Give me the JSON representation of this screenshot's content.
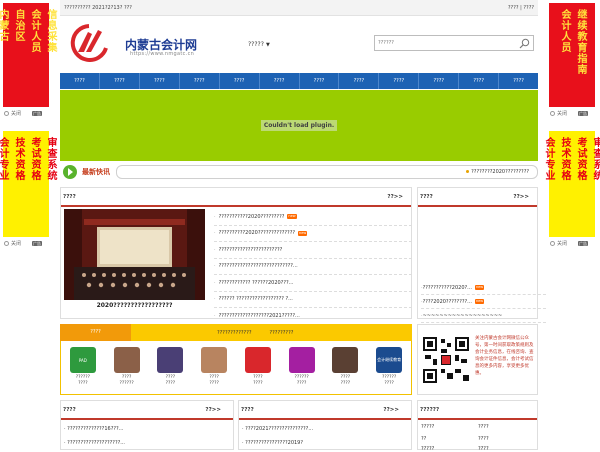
{
  "left_ads": [
    {
      "cols": [
        "内蒙古",
        "自治区"
      ],
      "cols2": [
        "会计人员",
        "信息采集"
      ],
      "theme": "red",
      "close": "关闭",
      "badge": "广告"
    },
    {
      "cols": [
        "会计专业",
        "技术资格"
      ],
      "cols2": [
        "考试资格",
        "审查系统"
      ],
      "theme": "yellow",
      "close": "关闭",
      "badge": "广告"
    }
  ],
  "right_ads": [
    {
      "cols": [
        "会计人员"
      ],
      "cols2": [
        "继续教育指南"
      ],
      "theme": "red",
      "close": "关闭",
      "badge": "广告"
    },
    {
      "cols": [
        "会计专业",
        "技术资格"
      ],
      "cols2": [
        "考试资格",
        "审查系统"
      ],
      "theme": "yellow",
      "close": "关闭",
      "badge": "广告"
    }
  ],
  "topbar": {
    "left": "?????????? 2021?2?13? ???",
    "right": "???? | ????"
  },
  "header": {
    "site_name": "内蒙古会计网",
    "site_url": "https://www.nmgatc.cn",
    "menu_label": "?????",
    "search_placeholder": "??????"
  },
  "nav": [
    "????",
    "????",
    "????",
    "????",
    "????",
    "????",
    "????",
    "????",
    "????",
    "????",
    "????",
    "????"
  ],
  "plugin_message": "Couldn't load plugin.",
  "ticker": {
    "title": "最新快讯",
    "text": "????????2020?????????"
  },
  "news_panel": {
    "title": "????",
    "more": "??>>",
    "photo_caption": "2020?????????????????",
    "photo_banner": "",
    "items": [
      {
        "text": "???????????2020?????????",
        "new": true
      },
      {
        "text": "??????????2020??????????????",
        "new": true
      },
      {
        "text": "????????????????????????",
        "new": false
      },
      {
        "text": "????????????????????????????...",
        "new": false
      },
      {
        "text": "???????????? ??????2020???...",
        "new": false
      },
      {
        "text": "?????? ?????????????????? ?...",
        "new": false
      },
      {
        "text": "???????????????????2021?????...",
        "new": false
      }
    ]
  },
  "notice_panel": {
    "title": "????",
    "more": "??>>",
    "items": [
      {
        "text": "???????????2020?...",
        "new": true
      },
      {
        "text": "????2020????????...",
        "new": true
      },
      {
        "text": "~~~~~~~~~~~~~~~~~~~",
        "new": false
      }
    ]
  },
  "service": {
    "tab_active": "????",
    "tab_others": [
      "?????????????",
      "?????????"
    ],
    "items": [
      {
        "label": "??????\n????",
        "color": "#2e9a3e",
        "badge_text": "PAD"
      },
      {
        "label": "????\n??????",
        "color": "#8b6048",
        "badge_text": ""
      },
      {
        "label": "????\n????",
        "color": "#4a3f75",
        "badge_text": ""
      },
      {
        "label": "????\n????",
        "color": "#b88460",
        "badge_text": ""
      },
      {
        "label": "????\n????",
        "color": "#d9272c",
        "badge_text": ""
      },
      {
        "label": "??????\n????",
        "color": "#a41fa1",
        "badge_text": ""
      },
      {
        "label": "????\n????",
        "color": "#5a4033",
        "badge_text": ""
      },
      {
        "label": "??????\n????",
        "color": "#1b4b8f",
        "badge_text": "会计继续教育"
      }
    ]
  },
  "qr_text": "关注内蒙古会计网微信公众号，第一时间获取政策规则及会计业务信息，在线咨询、查询会计证件信息，会计考试信息的更多内容，享受更多优惠。",
  "bottom_panels": [
    {
      "title": "????",
      "more": "??>>",
      "rows": [
        "· ??????????????16???...",
        "· ????????????????????..."
      ]
    },
    {
      "title": "????",
      "more": "??>>",
      "rows": [
        "· ????2021???????????????...",
        "· ????????????????2019?"
      ]
    },
    {
      "title": "??????",
      "more": "",
      "rows": [
        "?????",
        "??",
        "?????",
        "??"
      ],
      "rows2": [
        "????",
        "????",
        "????",
        "????"
      ]
    }
  ]
}
